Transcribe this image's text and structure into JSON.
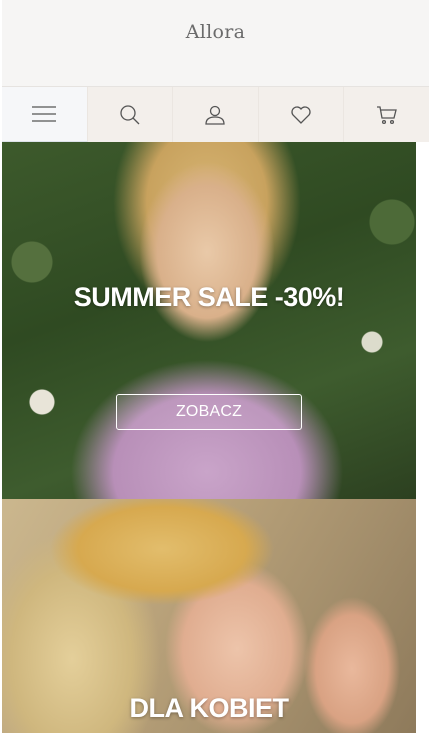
{
  "header": {
    "logo": "Allora"
  },
  "toolbar": {
    "items": [
      {
        "icon": "menu-icon"
      },
      {
        "icon": "search-icon"
      },
      {
        "icon": "account-icon"
      },
      {
        "icon": "wishlist-heart-icon"
      },
      {
        "icon": "cart-icon"
      }
    ]
  },
  "banners": [
    {
      "title": "SUMMER SALE -30%!",
      "button_label": "ZOBACZ"
    },
    {
      "title": "DLA KOBIET"
    }
  ]
}
